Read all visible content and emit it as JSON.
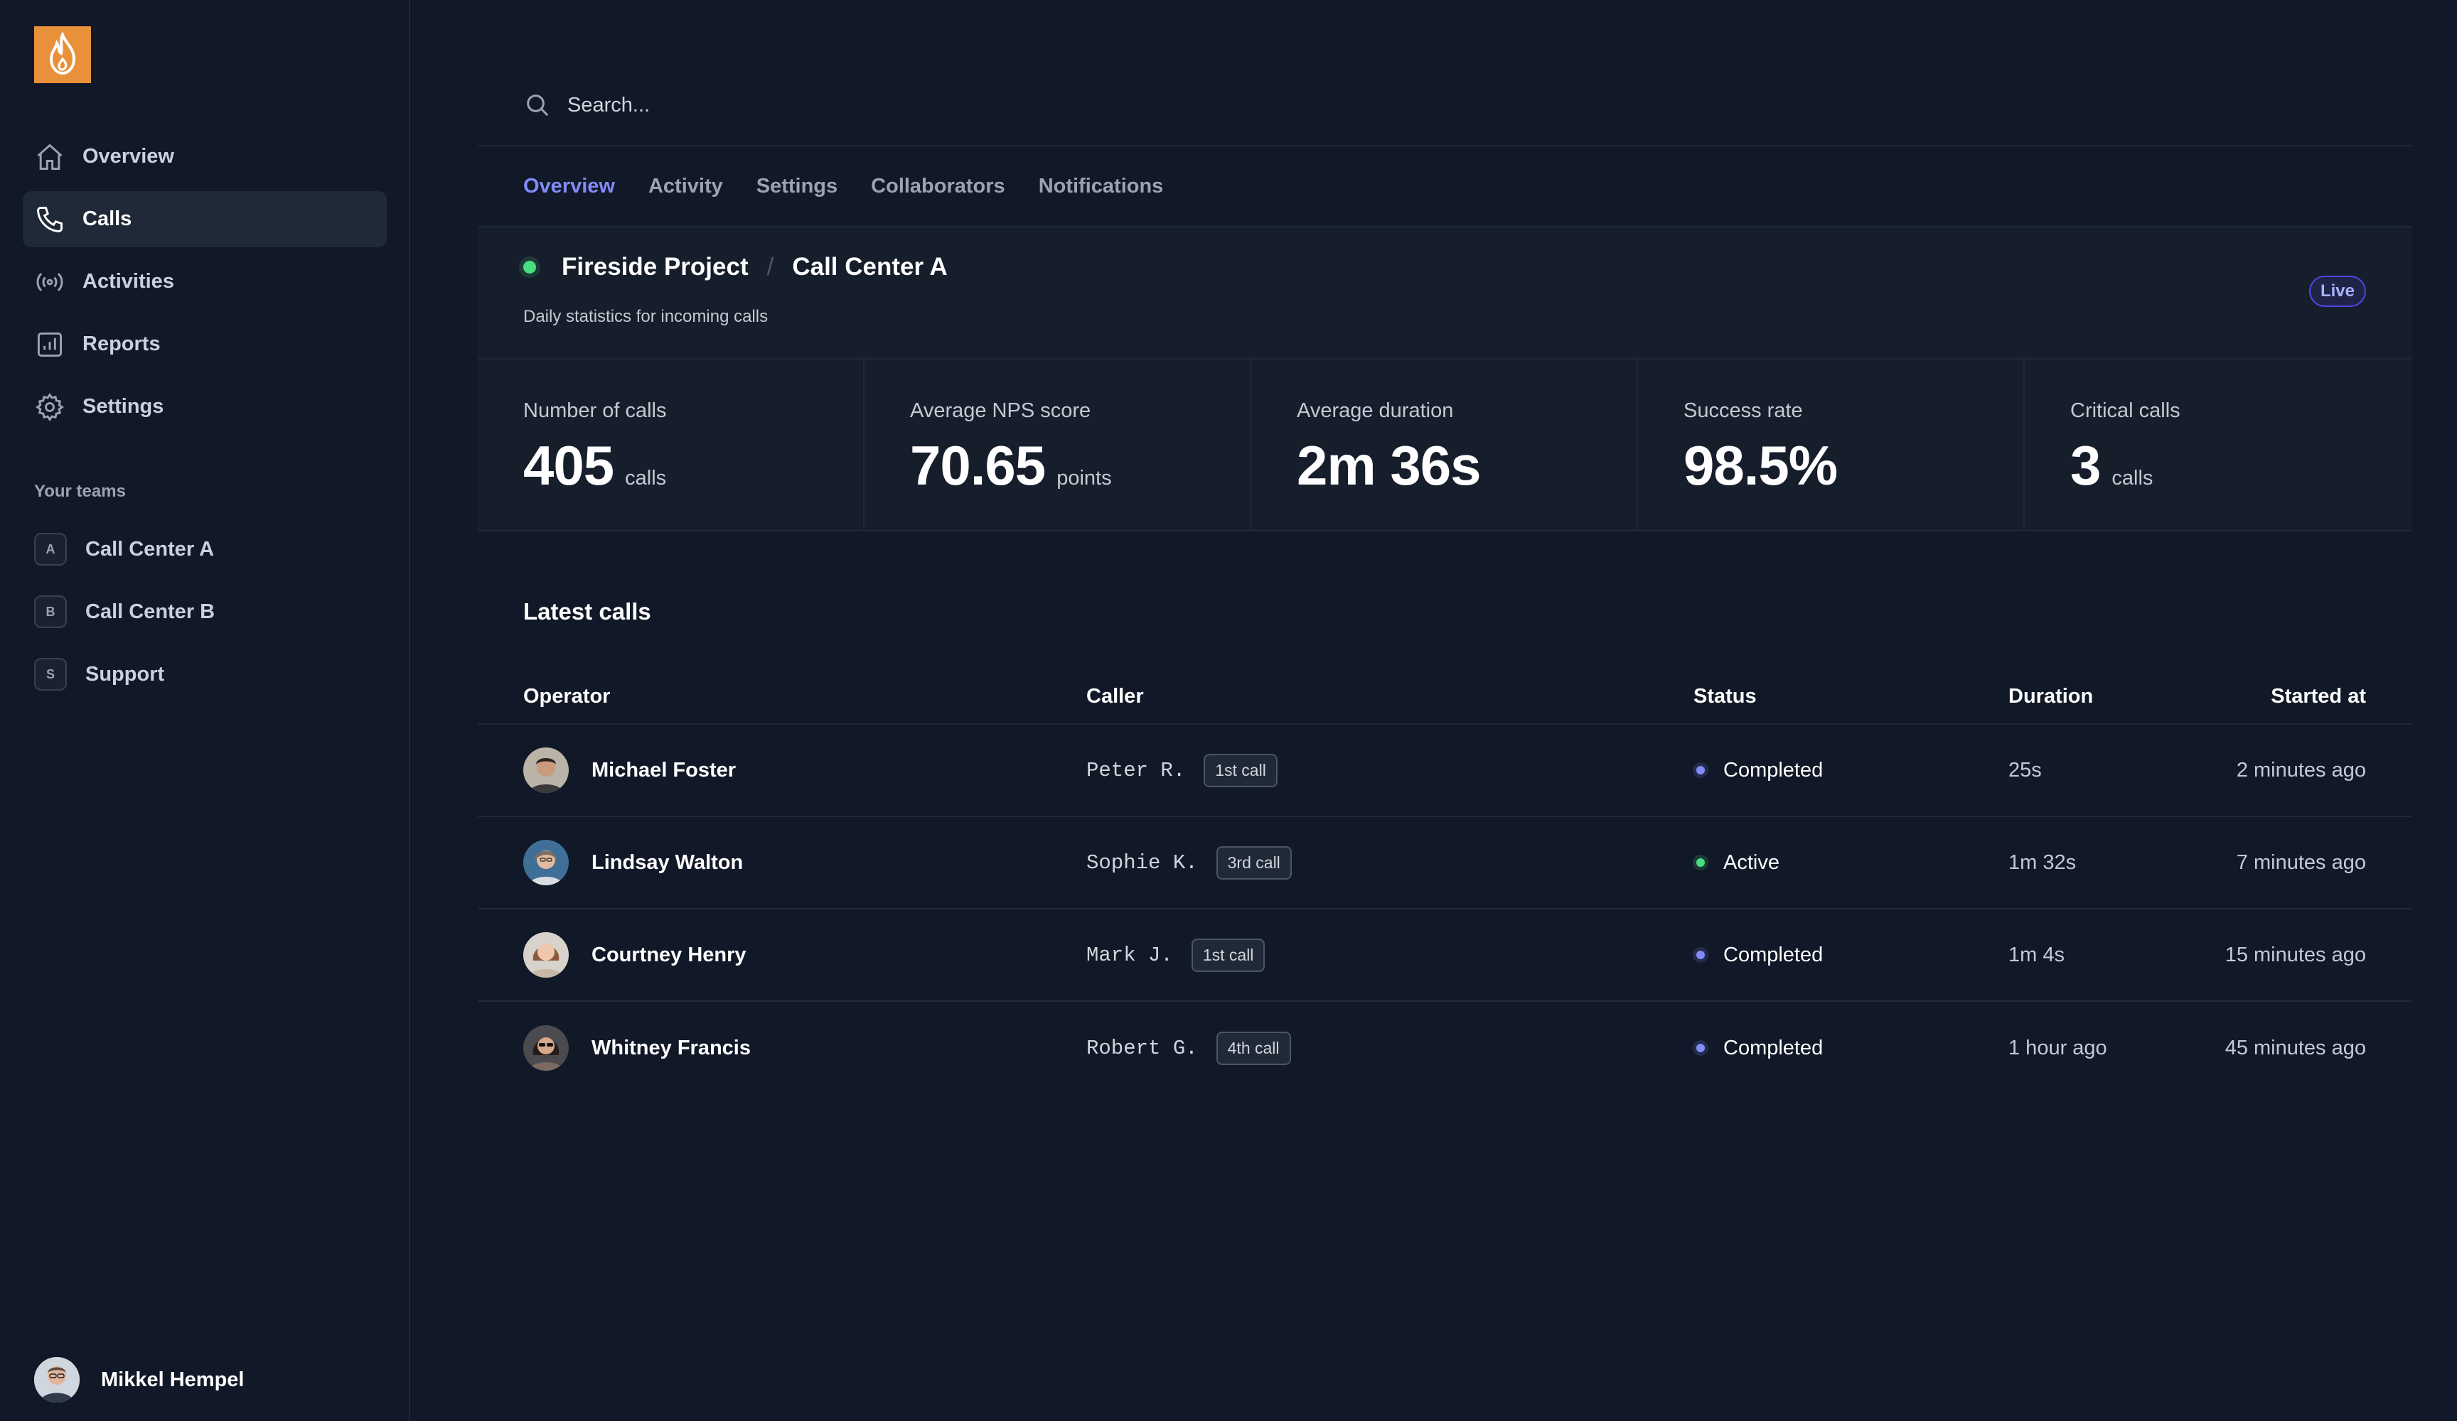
{
  "colors": {
    "background": "#111827",
    "accent": "#818cf8",
    "logo": "#e9913a",
    "status_live": "#4ade80",
    "status_completed": "#818cf8",
    "status_active": "#4ade80"
  },
  "sidebar": {
    "logo_icon": "flame-icon",
    "nav": [
      {
        "label": "Overview",
        "icon": "home-icon"
      },
      {
        "label": "Calls",
        "icon": "phone-icon",
        "active": true
      },
      {
        "label": "Activities",
        "icon": "signal-icon"
      },
      {
        "label": "Reports",
        "icon": "chart-icon"
      },
      {
        "label": "Settings",
        "icon": "gear-icon"
      }
    ],
    "teams_heading": "Your teams",
    "teams": [
      {
        "initial": "A",
        "label": "Call Center A"
      },
      {
        "initial": "B",
        "label": "Call Center B"
      },
      {
        "initial": "S",
        "label": "Support"
      }
    ],
    "user": {
      "name": "Mikkel Hempel"
    }
  },
  "search": {
    "placeholder": "Search..."
  },
  "tabs": [
    {
      "label": "Overview",
      "active": true
    },
    {
      "label": "Activity"
    },
    {
      "label": "Settings"
    },
    {
      "label": "Collaborators"
    },
    {
      "label": "Notifications"
    }
  ],
  "project": {
    "name": "Fireside Project",
    "separator": "/",
    "team": "Call Center A",
    "subtitle": "Daily statistics for incoming calls",
    "badge": "Live"
  },
  "stats": [
    {
      "label": "Number of calls",
      "value": "405",
      "unit": "calls"
    },
    {
      "label": "Average NPS score",
      "value": "70.65",
      "unit": "points"
    },
    {
      "label": "Average duration",
      "value": "2m 36s",
      "unit": ""
    },
    {
      "label": "Success rate",
      "value": "98.5%",
      "unit": ""
    },
    {
      "label": "Critical calls",
      "value": "3",
      "unit": "calls"
    }
  ],
  "latest": {
    "title": "Latest calls",
    "columns": {
      "operator": "Operator",
      "caller": "Caller",
      "status": "Status",
      "duration": "Duration",
      "started": "Started at"
    },
    "rows": [
      {
        "operator": "Michael Foster",
        "caller": "Peter R.",
        "call_count": "1st call",
        "status": "Completed",
        "duration": "25s",
        "started": "2 minutes ago"
      },
      {
        "operator": "Lindsay Walton",
        "caller": "Sophie K.",
        "call_count": "3rd call",
        "status": "Active",
        "duration": "1m 32s",
        "started": "7 minutes ago"
      },
      {
        "operator": "Courtney Henry",
        "caller": "Mark J.",
        "call_count": "1st call",
        "status": "Completed",
        "duration": "1m 4s",
        "started": "15 minutes ago"
      },
      {
        "operator": "Whitney Francis",
        "caller": "Robert G.",
        "call_count": "4th call",
        "status": "Completed",
        "duration": "1 hour ago",
        "started": "45 minutes ago"
      }
    ]
  }
}
